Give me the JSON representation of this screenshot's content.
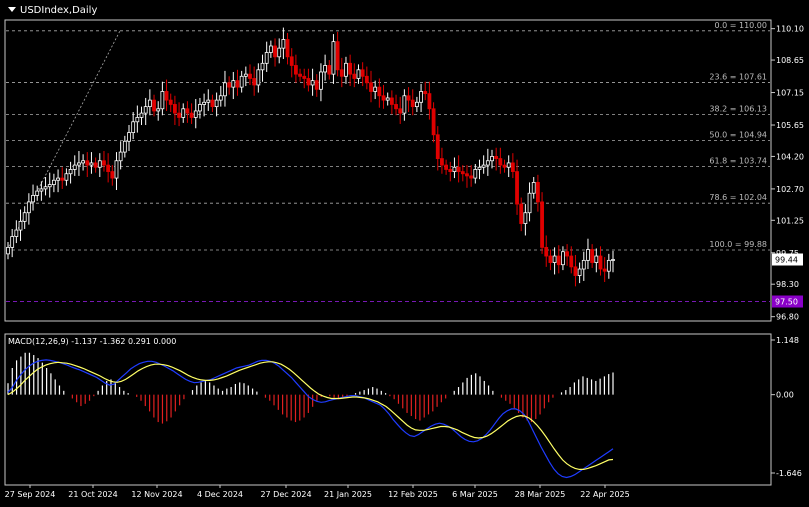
{
  "window": {
    "symbol_title": "USDIndex,Daily"
  },
  "colors": {
    "background": "#000000",
    "bull_candle": "#ffffff",
    "bear_candle": "#e00000",
    "grid": "#aaaaaa",
    "macd_line": "#1f3cff",
    "signal_line": "#ffff66",
    "hist_up": "#ffffff",
    "hist_down": "#e02020",
    "price_tag_bg": "#ffffff",
    "level_tag_bg": "#8a00c8"
  },
  "price_panel": {
    "y_ticks": [
      "110.10",
      "108.65",
      "107.15",
      "105.65",
      "104.20",
      "102.70",
      "101.25",
      "99.75",
      "98.30",
      "96.80"
    ],
    "current_price": "99.44",
    "horizontal_level": "97.50",
    "fib_levels": [
      {
        "label": "0.0 = 110.00",
        "price": 110.0
      },
      {
        "label": "23.6 = 107.61",
        "price": 107.61
      },
      {
        "label": "38.2 = 106.13",
        "price": 106.13
      },
      {
        "label": "50.0 = 104.94",
        "price": 104.94
      },
      {
        "label": "61.8 = 103.74",
        "price": 103.74
      },
      {
        "label": "78.6 = 102.04",
        "price": 102.04
      },
      {
        "label": "100.0 = 99.88",
        "price": 99.88
      }
    ]
  },
  "macd_panel": {
    "title": "MACD(12,26,9) -1.137 -1.362 0.291 0.000",
    "y_ticks": [
      "1.148",
      "0.00",
      "-1.646"
    ]
  },
  "x_axis": {
    "labels": [
      "27 Sep 2024",
      "21 Oct 2024",
      "12 Nov 2024",
      "4 Dec 2024",
      "27 Dec 2024",
      "21 Jan 2025",
      "12 Feb 2025",
      "6 Mar 2025",
      "28 Mar 2025",
      "22 Apr 2025"
    ]
  },
  "chart_data": {
    "type": "candlestick",
    "title": "USDIndex,Daily",
    "ylim": [
      96.6,
      110.5
    ],
    "closes": [
      100.0,
      100.5,
      100.8,
      101.2,
      101.6,
      102.1,
      102.4,
      102.6,
      102.7,
      102.8,
      102.9,
      103.1,
      103.2,
      103.1,
      103.4,
      103.6,
      103.8,
      103.9,
      104.0,
      103.8,
      103.9,
      103.7,
      104.0,
      103.8,
      103.5,
      103.2,
      104.0,
      104.4,
      104.9,
      105.3,
      105.8,
      106.0,
      106.2,
      106.5,
      106.8,
      106.3,
      106.4,
      107.2,
      106.8,
      106.6,
      106.2,
      106.0,
      106.4,
      106.2,
      106.0,
      106.3,
      106.6,
      106.7,
      106.8,
      106.5,
      106.8,
      107.0,
      107.6,
      107.4,
      107.7,
      107.4,
      107.9,
      108.0,
      107.8,
      107.5,
      108.2,
      108.5,
      109.0,
      109.3,
      108.8,
      109.2,
      109.6,
      108.8,
      108.4,
      108.0,
      107.9,
      107.8,
      107.5,
      107.7,
      107.3,
      108.1,
      108.4,
      108.0,
      109.5,
      108.2,
      107.9,
      108.5,
      108.0,
      107.8,
      108.2,
      107.9,
      107.6,
      107.2,
      107.4,
      107.0,
      106.8,
      106.9,
      106.6,
      106.4,
      106.2,
      107.0,
      106.8,
      106.5,
      106.7,
      107.2,
      107.1,
      106.4,
      105.2,
      104.1,
      103.8,
      103.6,
      103.5,
      103.7,
      103.5,
      103.4,
      103.3,
      103.2,
      103.6,
      103.7,
      103.8,
      104.0,
      104.2,
      104.1,
      103.8,
      103.7,
      103.9,
      103.5,
      102.0,
      101.1,
      101.6,
      102.5,
      103.0,
      102.1,
      100.0,
      99.6,
      99.3,
      99.6,
      99.2,
      99.8,
      99.6,
      99.1,
      98.7,
      99.0,
      99.4,
      99.9,
      99.3,
      99.6,
      99.0,
      98.9,
      99.4,
      99.44
    ],
    "macd": [
      0.05,
      0.15,
      0.3,
      0.42,
      0.52,
      0.6,
      0.66,
      0.7,
      0.72,
      0.73,
      0.72,
      0.7,
      0.68,
      0.65,
      0.62,
      0.58,
      0.55,
      0.52,
      0.48,
      0.44,
      0.4,
      0.36,
      0.3,
      0.24,
      0.2,
      0.22,
      0.3,
      0.38,
      0.46,
      0.54,
      0.6,
      0.65,
      0.68,
      0.7,
      0.7,
      0.68,
      0.64,
      0.6,
      0.55,
      0.5,
      0.44,
      0.38,
      0.32,
      0.28,
      0.25,
      0.26,
      0.28,
      0.3,
      0.32,
      0.36,
      0.4,
      0.44,
      0.48,
      0.52,
      0.56,
      0.58,
      0.6,
      0.62,
      0.66,
      0.7,
      0.72,
      0.72,
      0.7,
      0.66,
      0.6,
      0.52,
      0.44,
      0.36,
      0.26,
      0.16,
      0.06,
      -0.04,
      -0.1,
      -0.14,
      -0.16,
      -0.15,
      -0.12,
      -0.1,
      -0.08,
      -0.06,
      -0.04,
      -0.02,
      -0.02,
      -0.04,
      -0.06,
      -0.1,
      -0.14,
      -0.18,
      -0.22,
      -0.3,
      -0.4,
      -0.52,
      -0.62,
      -0.72,
      -0.8,
      -0.86,
      -0.88,
      -0.84,
      -0.78,
      -0.72,
      -0.66,
      -0.62,
      -0.6,
      -0.62,
      -0.66,
      -0.72,
      -0.8,
      -0.88,
      -0.94,
      -0.98,
      -0.99,
      -0.97,
      -0.92,
      -0.84,
      -0.74,
      -0.62,
      -0.5,
      -0.4,
      -0.34,
      -0.3,
      -0.3,
      -0.34,
      -0.42,
      -0.56,
      -0.74,
      -0.92,
      -1.1,
      -1.26,
      -1.42,
      -1.56,
      -1.66,
      -1.72,
      -1.74,
      -1.72,
      -1.68,
      -1.62,
      -1.56,
      -1.5,
      -1.44,
      -1.38,
      -1.32,
      -1.26,
      -1.2,
      -1.137
    ],
    "signal": [
      0.0,
      0.05,
      0.12,
      0.2,
      0.3,
      0.38,
      0.46,
      0.53,
      0.58,
      0.62,
      0.65,
      0.67,
      0.68,
      0.67,
      0.66,
      0.64,
      0.61,
      0.58,
      0.55,
      0.51,
      0.47,
      0.43,
      0.39,
      0.34,
      0.3,
      0.27,
      0.26,
      0.28,
      0.32,
      0.38,
      0.44,
      0.5,
      0.55,
      0.59,
      0.62,
      0.64,
      0.64,
      0.63,
      0.61,
      0.58,
      0.54,
      0.5,
      0.45,
      0.4,
      0.36,
      0.33,
      0.31,
      0.3,
      0.3,
      0.31,
      0.33,
      0.36,
      0.39,
      0.43,
      0.47,
      0.51,
      0.54,
      0.57,
      0.6,
      0.63,
      0.66,
      0.68,
      0.69,
      0.69,
      0.67,
      0.64,
      0.59,
      0.53,
      0.46,
      0.38,
      0.3,
      0.22,
      0.14,
      0.07,
      0.01,
      -0.03,
      -0.06,
      -0.08,
      -0.08,
      -0.08,
      -0.07,
      -0.06,
      -0.05,
      -0.05,
      -0.06,
      -0.07,
      -0.09,
      -0.12,
      -0.15,
      -0.2,
      -0.25,
      -0.32,
      -0.4,
      -0.48,
      -0.56,
      -0.64,
      -0.7,
      -0.74,
      -0.75,
      -0.75,
      -0.73,
      -0.71,
      -0.69,
      -0.67,
      -0.67,
      -0.68,
      -0.71,
      -0.74,
      -0.79,
      -0.83,
      -0.87,
      -0.9,
      -0.91,
      -0.9,
      -0.87,
      -0.82,
      -0.76,
      -0.69,
      -0.62,
      -0.55,
      -0.5,
      -0.46,
      -0.44,
      -0.45,
      -0.49,
      -0.56,
      -0.65,
      -0.76,
      -0.88,
      -1.01,
      -1.14,
      -1.26,
      -1.37,
      -1.45,
      -1.51,
      -1.55,
      -1.57,
      -1.57,
      -1.55,
      -1.52,
      -1.49,
      -1.45,
      -1.41,
      -1.37,
      -1.362
    ],
    "histogram": [
      0.15,
      0.35,
      0.45,
      0.5,
      0.55,
      0.55,
      0.52,
      0.48,
      0.42,
      0.35,
      0.28,
      0.2,
      0.12,
      0.05,
      0.0,
      -0.05,
      -0.1,
      -0.15,
      -0.12,
      -0.08,
      -0.02,
      0.05,
      0.12,
      0.18,
      0.2,
      0.16,
      0.1,
      0.05,
      0.02,
      0.0,
      -0.03,
      -0.08,
      -0.15,
      -0.22,
      -0.3,
      -0.36,
      -0.38,
      -0.35,
      -0.3,
      -0.22,
      -0.14,
      -0.06,
      0.0,
      0.06,
      0.12,
      0.16,
      0.18,
      0.16,
      0.12,
      0.08,
      0.05,
      0.08,
      0.1,
      0.14,
      0.16,
      0.15,
      0.12,
      0.08,
      0.04,
      0.0,
      -0.04,
      -0.08,
      -0.14,
      -0.2,
      -0.26,
      -0.3,
      -0.34,
      -0.36,
      -0.34,
      -0.3,
      -0.24,
      -0.16,
      -0.08,
      -0.03,
      0.0,
      -0.02,
      -0.04,
      -0.06,
      -0.04,
      -0.02,
      0.0,
      0.02,
      0.04,
      0.06,
      0.08,
      0.1,
      0.08,
      0.05,
      0.02,
      -0.02,
      -0.06,
      -0.12,
      -0.18,
      -0.24,
      -0.28,
      -0.32,
      -0.34,
      -0.3,
      -0.26,
      -0.22,
      -0.16,
      -0.1,
      -0.05,
      0.0,
      0.05,
      0.1,
      0.16,
      0.22,
      0.26,
      0.28,
      0.24,
      0.18,
      0.12,
      0.05,
      0.0,
      -0.04,
      -0.08,
      -0.12,
      -0.18,
      -0.24,
      -0.3,
      -0.34,
      -0.36,
      -0.32,
      -0.26,
      -0.18,
      -0.1,
      -0.04,
      0.0,
      0.03,
      0.06,
      0.1,
      0.16,
      0.2,
      0.24,
      0.22,
      0.2,
      0.18,
      0.21,
      0.24,
      0.27,
      0.291
    ]
  }
}
